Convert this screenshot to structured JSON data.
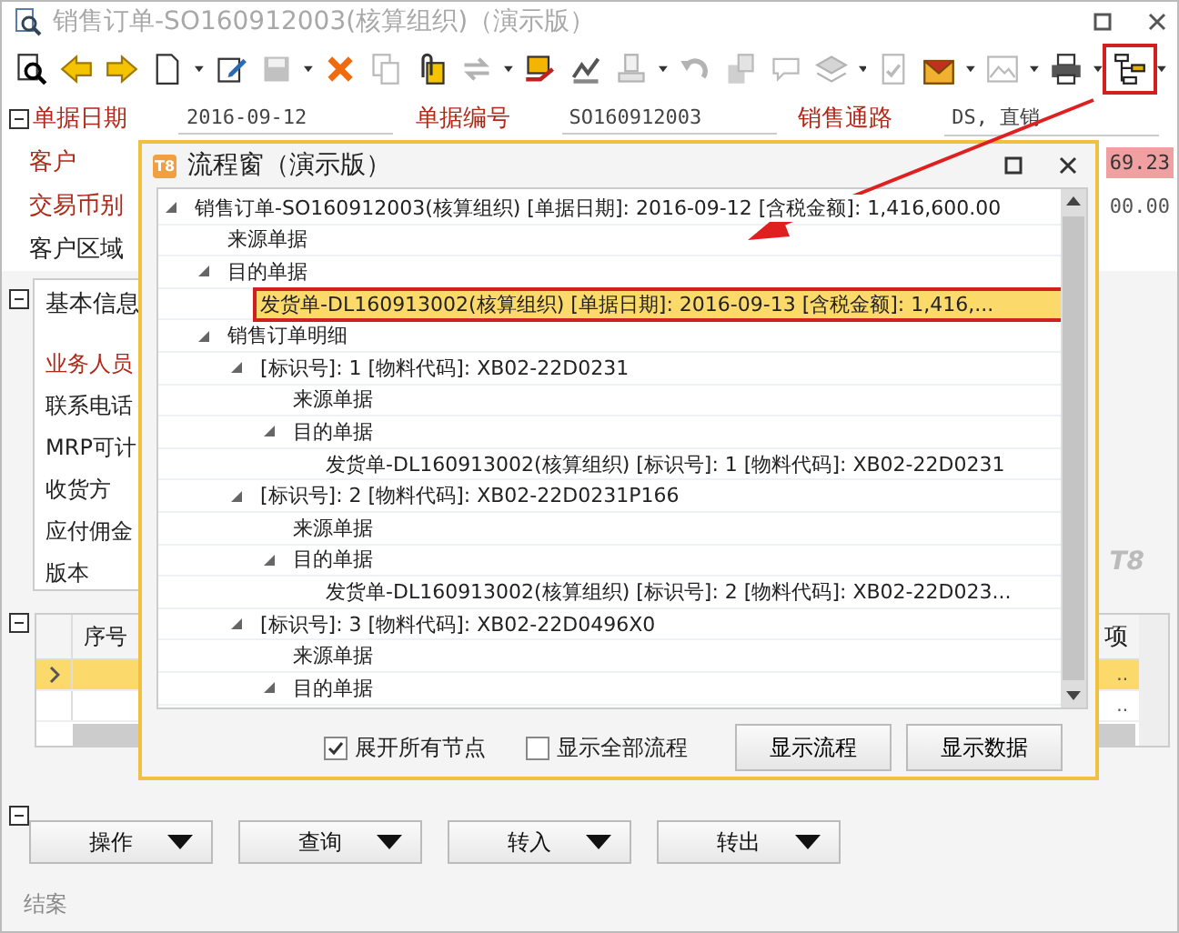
{
  "window": {
    "title": "销售订单-SO160912003(核算组织)（演示版）"
  },
  "toolbar": [
    {
      "kind": "preview",
      "disabled": false,
      "dropdown": false
    },
    {
      "kind": "back",
      "disabled": false,
      "dropdown": false
    },
    {
      "kind": "forward",
      "disabled": false,
      "dropdown": false
    },
    {
      "kind": "new",
      "disabled": false,
      "dropdown": true
    },
    {
      "kind": "edit",
      "disabled": false,
      "dropdown": false
    },
    {
      "kind": "save",
      "disabled": true,
      "dropdown": true
    },
    {
      "kind": "delete",
      "disabled": false,
      "dropdown": false
    },
    {
      "kind": "copy",
      "disabled": true,
      "dropdown": false
    },
    {
      "kind": "attach",
      "disabled": false,
      "dropdown": false
    },
    {
      "kind": "swap",
      "disabled": true,
      "dropdown": true
    },
    {
      "kind": "approve",
      "disabled": false,
      "dropdown": false
    },
    {
      "kind": "sign",
      "disabled": false,
      "dropdown": false
    },
    {
      "kind": "stamp",
      "disabled": true,
      "dropdown": true
    },
    {
      "kind": "undo",
      "disabled": true,
      "dropdown": false
    },
    {
      "kind": "lock",
      "disabled": true,
      "dropdown": false
    },
    {
      "kind": "comment",
      "disabled": true,
      "dropdown": false
    },
    {
      "kind": "layers",
      "disabled": true,
      "dropdown": true
    },
    {
      "kind": "check",
      "disabled": true,
      "dropdown": false
    },
    {
      "kind": "mail",
      "disabled": false,
      "dropdown": true
    },
    {
      "kind": "image",
      "disabled": true,
      "dropdown": true
    },
    {
      "kind": "print",
      "disabled": false,
      "dropdown": true
    },
    {
      "kind": "flow",
      "disabled": false,
      "dropdown": true,
      "highlighted": true
    }
  ],
  "header_fields": [
    {
      "label": "单据日期",
      "value": "2016-09-12",
      "required": true
    },
    {
      "label": "单据编号",
      "value": "SO160912003",
      "required": true
    },
    {
      "label": "销售通路",
      "value": "DS, 直销",
      "required": true
    }
  ],
  "header_rows": [
    {
      "label": "客户",
      "required": true,
      "value": "69.23",
      "highlight": true
    },
    {
      "label": "交易币别",
      "required": true,
      "value": "00.00",
      "highlight": false
    },
    {
      "label": "客户区域",
      "required": false
    }
  ],
  "basic_info": {
    "title": "基本信息",
    "fields": [
      {
        "label": "业务人员",
        "required": true
      },
      {
        "label": "联系电话",
        "required": false
      },
      {
        "label": "MRP可计",
        "required": false
      },
      {
        "label": "收货方",
        "required": false
      },
      {
        "label": "应付佣金",
        "required": false
      },
      {
        "label": "版本",
        "required": false
      }
    ]
  },
  "grid": {
    "columns": [
      "序号",
      "项"
    ],
    "rows": [
      {
        "selected": true,
        "column_2": ".."
      },
      {
        "selected": false,
        "column_2": ".."
      }
    ]
  },
  "buttons": [
    "操作",
    "查询",
    "转入",
    "转出"
  ],
  "status": "结案",
  "logo": "T8",
  "dialog": {
    "title": "流程窗（演示版）",
    "icon_text": "T8",
    "tree": [
      {
        "text": "销售订单-SO160912003(核算组织)  [单据日期]: 2016-09-12 [含税金额]: 1,416,600.00",
        "expanded": true,
        "selected": false,
        "children": [
          {
            "text": "来源单据",
            "selected": false
          },
          {
            "text": "目的单据",
            "expanded": true,
            "selected": false,
            "children": [
              {
                "text": "发货单-DL160913002(核算组织)  [单据日期]: 2016-09-13 [含税金额]: 1,416,...",
                "selected": true
              }
            ]
          },
          {
            "text": "销售订单明细",
            "expanded": true,
            "selected": false,
            "children": [
              {
                "text": "[标识号]: 1 [物料代码]: XB02-22D0231",
                "expanded": true,
                "selected": false,
                "children": [
                  {
                    "text": "来源单据",
                    "selected": false
                  },
                  {
                    "text": "目的单据",
                    "expanded": true,
                    "selected": false,
                    "children": [
                      {
                        "text": "发货单-DL160913002(核算组织)  [标识号]: 1 [物料代码]: XB02-22D0231",
                        "selected": false
                      }
                    ]
                  }
                ]
              },
              {
                "text": "[标识号]: 2 [物料代码]: XB02-22D0231P166",
                "expanded": true,
                "selected": false,
                "children": [
                  {
                    "text": "来源单据",
                    "selected": false
                  },
                  {
                    "text": "目的单据",
                    "expanded": true,
                    "selected": false,
                    "children": [
                      {
                        "text": "发货单-DL160913002(核算组织)  [标识号]: 2 [物料代码]: XB02-22D023...",
                        "selected": false
                      }
                    ]
                  }
                ]
              },
              {
                "text": "[标识号]: 3 [物料代码]: XB02-22D0496X0",
                "expanded": true,
                "selected": false,
                "children": [
                  {
                    "text": "来源单据",
                    "selected": false
                  },
                  {
                    "text": "目的单据",
                    "expanded": true,
                    "selected": false
                  }
                ]
              }
            ]
          }
        ]
      }
    ],
    "options": [
      {
        "label": "展开所有节点",
        "checked": true
      },
      {
        "label": "显示全部流程",
        "checked": false
      }
    ],
    "buttons": [
      "显示流程",
      "显示数据"
    ]
  }
}
